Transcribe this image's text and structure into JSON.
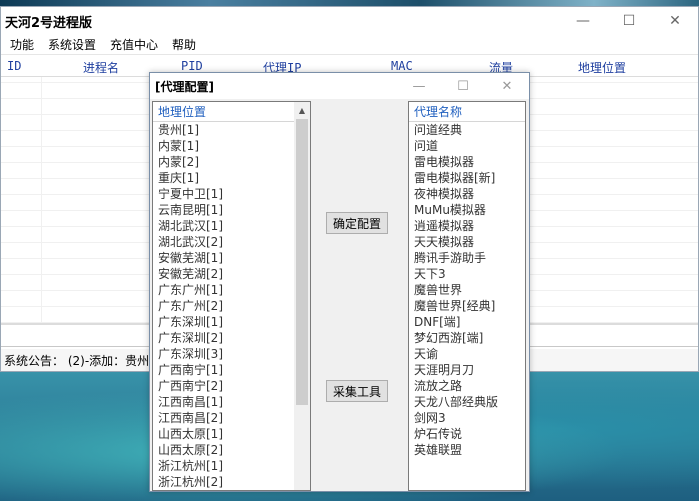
{
  "window": {
    "title": "天河2号进程版",
    "minimize_icon": "minimize-icon",
    "maximize_icon": "maximize-icon",
    "close_icon": "close-icon"
  },
  "menu": [
    "功能",
    "系统设置",
    "充值中心",
    "帮助"
  ],
  "columns": [
    "ID",
    "进程名",
    "PID",
    "代理IP",
    "MAC",
    "流量",
    "地理位置"
  ],
  "status": "系统公告：  (2)-添加：贵州",
  "dialog": {
    "title": "[代理配置]",
    "left_header": "地理位置",
    "right_header": "代理名称",
    "left_items": [
      "贵州[1]",
      "内蒙[1]",
      "内蒙[2]",
      "重庆[1]",
      "宁夏中卫[1]",
      "云南昆明[1]",
      "湖北武汉[1]",
      "湖北武汉[2]",
      "安徽芜湖[1]",
      "安徽芜湖[2]",
      "广东广州[1]",
      "广东广州[2]",
      "广东深圳[1]",
      "广东深圳[2]",
      "广东深圳[3]",
      "广西南宁[1]",
      "广西南宁[2]",
      "江西南昌[1]",
      "江西南昌[2]",
      "山西太原[1]",
      "山西太原[2]",
      "浙江杭州[1]",
      "浙江杭州[2]"
    ],
    "right_items": [
      "问道经典",
      "问道",
      "雷电模拟器",
      "雷电模拟器[新]",
      "夜神模拟器",
      "MuMu模拟器",
      "逍遥模拟器",
      "天天模拟器",
      "腾讯手游助手",
      "天下3",
      "魔兽世界",
      "魔兽世界[经典]",
      "DNF[端]",
      "梦幻西游[端]",
      "天谕",
      "天涯明月刀",
      "流放之路",
      "天龙八部经典版",
      "剑网3",
      "炉石传说",
      "英雄联盟"
    ],
    "confirm_label": "确定配置",
    "collect_label": "采集工具"
  }
}
